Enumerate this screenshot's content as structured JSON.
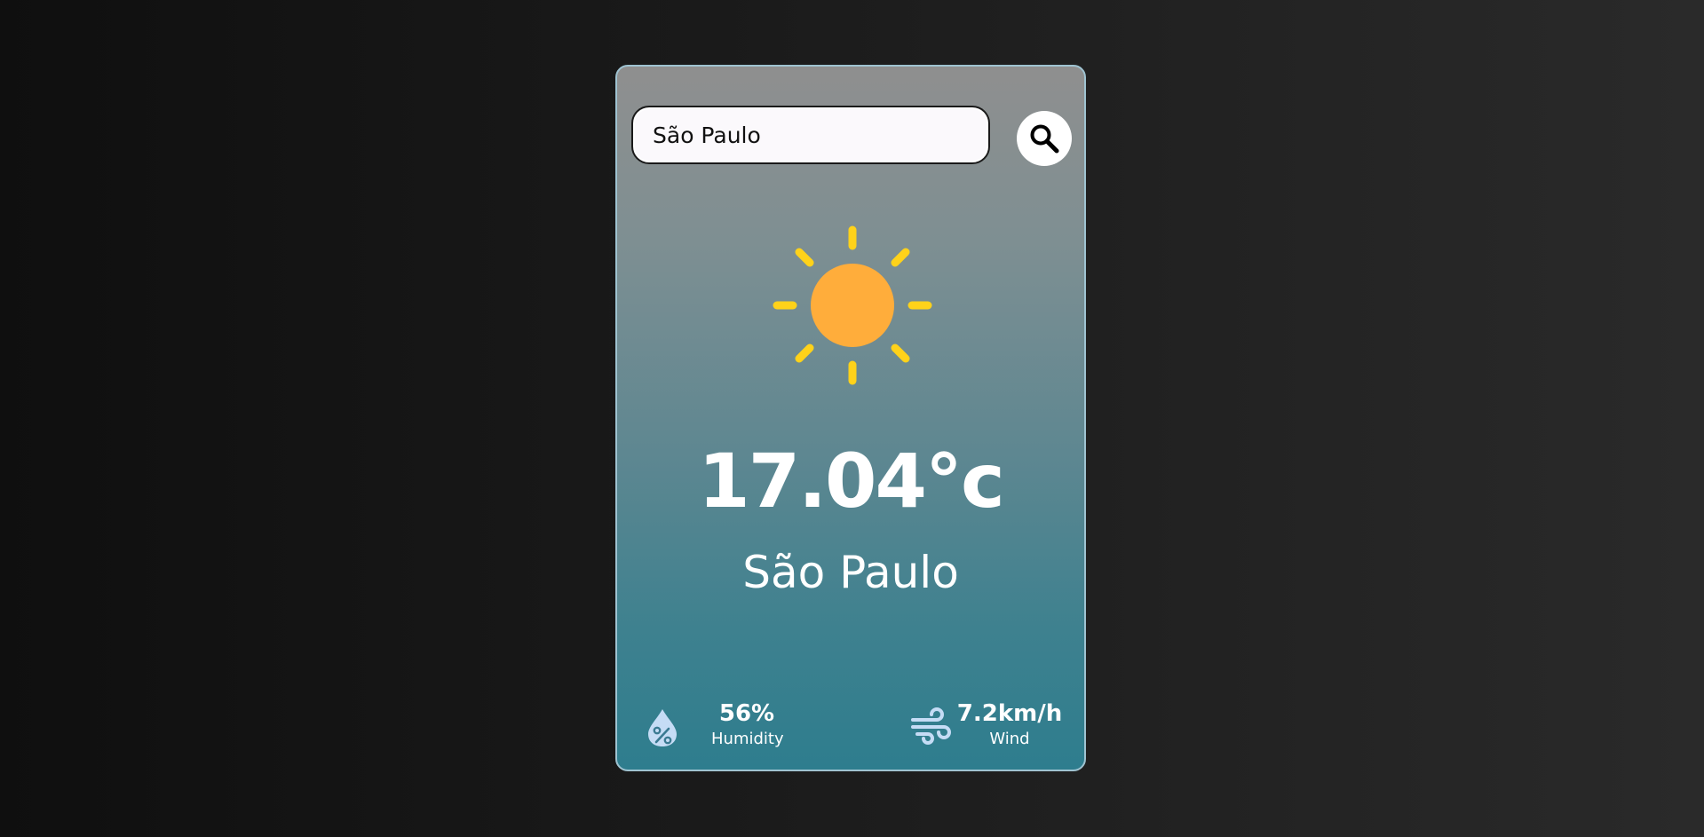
{
  "search": {
    "value": "São Paulo",
    "icon": "search-icon"
  },
  "weather": {
    "icon": "sun-icon",
    "temperature": "17.04°c",
    "city": "São Paulo"
  },
  "details": {
    "humidity": {
      "value": "56%",
      "label": "Humidity",
      "icon": "humidity-icon"
    },
    "wind": {
      "value": "7.2km/h",
      "label": "Wind",
      "icon": "wind-icon"
    }
  },
  "colors": {
    "sun_core": "#ffad3b",
    "sun_rays": "#ffd21a",
    "detail_icon": "#c5dcf5",
    "card_border": "#9fc3d1"
  }
}
